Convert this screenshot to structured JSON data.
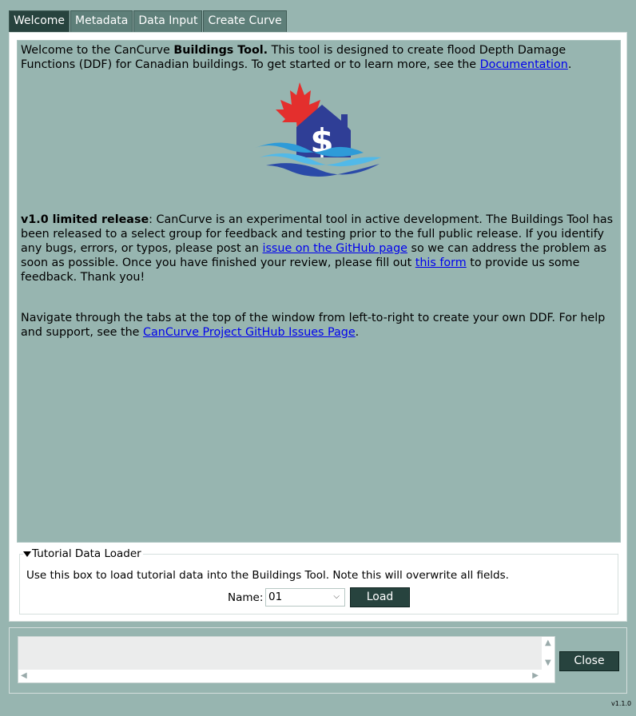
{
  "tabs": [
    {
      "label": "Welcome",
      "active": true
    },
    {
      "label": "Metadata"
    },
    {
      "label": "Data Input"
    },
    {
      "label": "Create Curve"
    }
  ],
  "welcome": {
    "intro_prefix": "Welcome to the CanCurve ",
    "intro_bold": "Buildings Tool.",
    "intro_rest": " This tool is designed to create flood Depth Damage Functions (DDF) for Canadian buildings. To get started or to learn more, see the ",
    "doc_link": "Documentation",
    "intro_end": ".",
    "release_bold": "v1.0 limited release",
    "release_text": ": CanCurve is an experimental tool in active development. The Buildings Tool has been released to a select group for feedback and testing prior to the full public release. If you identify any bugs, errors, or typos, please post an ",
    "issue_link": "issue on the GitHub page",
    "release_text2": " so we can address the problem as soon as possible. Once you have finished your review, please fill out ",
    "form_link": "this form",
    "release_text3": " to provide us some feedback. Thank you!",
    "nav_text": "Navigate through the tabs at the top of the window from left-to-right to create your own DDF. For help and support, see the ",
    "issues_page_link": "CanCurve Project GitHub Issues Page",
    "nav_end": "."
  },
  "tutorial": {
    "title": "Tutorial Data Loader",
    "description": "Use this box to load tutorial data into the Buildings Tool. Note this will overwrite all fields.",
    "name_label": "Name:",
    "selected": "01",
    "load_label": "Load"
  },
  "footer": {
    "close_label": "Close",
    "version": "v1.1.0"
  },
  "colors": {
    "background": "#97b5b0",
    "tab_active": "#27433e",
    "tab": "#5e7f79",
    "button": "#27433e",
    "link": "#0000ee"
  },
  "icons": {
    "logo": "cancurve-logo",
    "dropdown": "chevron-down-icon",
    "triangle": "collapse-triangle-icon"
  }
}
